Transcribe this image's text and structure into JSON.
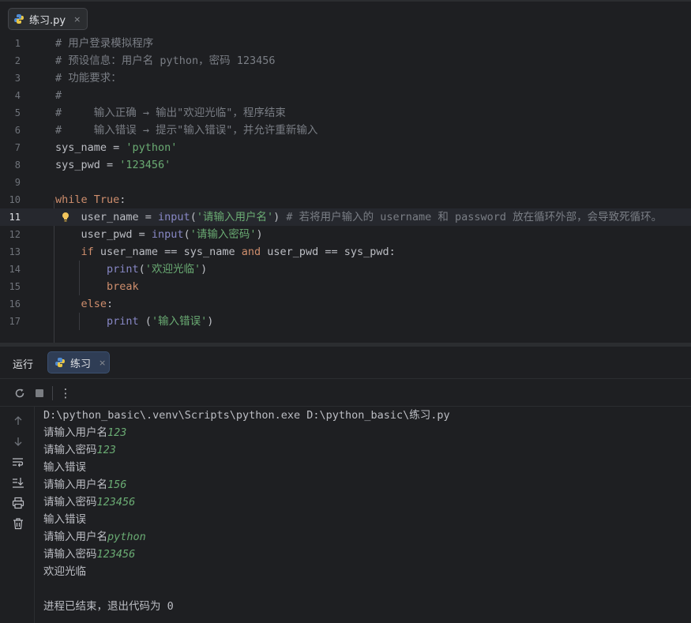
{
  "editor_tab": {
    "filename": "练习.py",
    "close": "×",
    "icon": "python-file-icon"
  },
  "code_lines": [
    {
      "num": "1",
      "parts": [
        {
          "t": "# 用户登录模拟程序",
          "c": "cmt"
        }
      ]
    },
    {
      "num": "2",
      "parts": [
        {
          "t": "# 预设信息：用户名 python，密码 123456",
          "c": "cmt"
        }
      ]
    },
    {
      "num": "3",
      "parts": [
        {
          "t": "# 功能要求：",
          "c": "cmt"
        }
      ]
    },
    {
      "num": "4",
      "parts": [
        {
          "t": "#",
          "c": "cmt"
        }
      ]
    },
    {
      "num": "5",
      "parts": [
        {
          "t": "#     输入正确 → 输出\"欢迎光临\"，程序结束",
          "c": "cmt"
        }
      ]
    },
    {
      "num": "6",
      "parts": [
        {
          "t": "#     输入错误 → 提示\"输入错误\"，并允许重新输入",
          "c": "cmt"
        }
      ]
    },
    {
      "num": "7",
      "parts": [
        {
          "t": "sys_name = ",
          "c": ""
        },
        {
          "t": "'python'",
          "c": "str"
        }
      ]
    },
    {
      "num": "8",
      "parts": [
        {
          "t": "sys_pwd = ",
          "c": ""
        },
        {
          "t": "'123456'",
          "c": "str"
        }
      ]
    },
    {
      "num": "9",
      "parts": []
    },
    {
      "num": "10",
      "parts": [
        {
          "t": "while ",
          "c": "kw"
        },
        {
          "t": "True",
          "c": "kw"
        },
        {
          "t": ":",
          "c": ""
        }
      ]
    },
    {
      "num": "11",
      "parts": [
        {
          "t": "    user_name = ",
          "c": ""
        },
        {
          "t": "input",
          "c": "fn"
        },
        {
          "t": "(",
          "c": ""
        },
        {
          "t": "'请输入用户名'",
          "c": "str"
        },
        {
          "t": ") ",
          "c": ""
        },
        {
          "t": "# 若将用户输入的 username 和 password 放在循环外部，会导致死循环。",
          "c": "cmt"
        }
      ]
    },
    {
      "num": "12",
      "parts": [
        {
          "t": "    user_pwd = ",
          "c": ""
        },
        {
          "t": "input",
          "c": "fn"
        },
        {
          "t": "(",
          "c": ""
        },
        {
          "t": "'请输入密码'",
          "c": "str"
        },
        {
          "t": ")",
          "c": ""
        }
      ]
    },
    {
      "num": "13",
      "parts": [
        {
          "t": "    ",
          "c": ""
        },
        {
          "t": "if ",
          "c": "kw"
        },
        {
          "t": "user_name == sys_name ",
          "c": ""
        },
        {
          "t": "and ",
          "c": "kw"
        },
        {
          "t": "user_pwd == sys_pwd:",
          "c": ""
        }
      ]
    },
    {
      "num": "14",
      "parts": [
        {
          "t": "        ",
          "c": ""
        },
        {
          "t": "print",
          "c": "fn"
        },
        {
          "t": "(",
          "c": ""
        },
        {
          "t": "'欢迎光临'",
          "c": "str"
        },
        {
          "t": ")",
          "c": ""
        }
      ]
    },
    {
      "num": "15",
      "parts": [
        {
          "t": "        ",
          "c": ""
        },
        {
          "t": "break",
          "c": "kw"
        }
      ]
    },
    {
      "num": "16",
      "parts": [
        {
          "t": "    ",
          "c": ""
        },
        {
          "t": "else",
          "c": "kw"
        },
        {
          "t": ":",
          "c": ""
        }
      ]
    },
    {
      "num": "17",
      "parts": [
        {
          "t": "        ",
          "c": ""
        },
        {
          "t": "print",
          "c": "fn"
        },
        {
          "t": " (",
          "c": ""
        },
        {
          "t": "'输入错误'",
          "c": "str"
        },
        {
          "t": ")",
          "c": ""
        }
      ]
    }
  ],
  "current_line": "11",
  "run_panel": {
    "title": "运行",
    "tab_label": "练习",
    "tab_close": "×",
    "more_label": "⋮"
  },
  "console_lines": [
    {
      "text": "D:\\python_basic\\.venv\\Scripts\\python.exe D:\\python_basic\\练习.py",
      "input": ""
    },
    {
      "text": "请输入用户名",
      "input": "123"
    },
    {
      "text": "请输入密码",
      "input": "123"
    },
    {
      "text": "输入错误",
      "input": ""
    },
    {
      "text": "请输入用户名",
      "input": "156"
    },
    {
      "text": "请输入密码",
      "input": "123456"
    },
    {
      "text": "输入错误",
      "input": ""
    },
    {
      "text": "请输入用户名",
      "input": "python"
    },
    {
      "text": "请输入密码",
      "input": "123456"
    },
    {
      "text": "欢迎光临",
      "input": ""
    },
    {
      "text": "",
      "input": ""
    },
    {
      "text": "进程已结束，退出代码为 0",
      "input": ""
    }
  ]
}
